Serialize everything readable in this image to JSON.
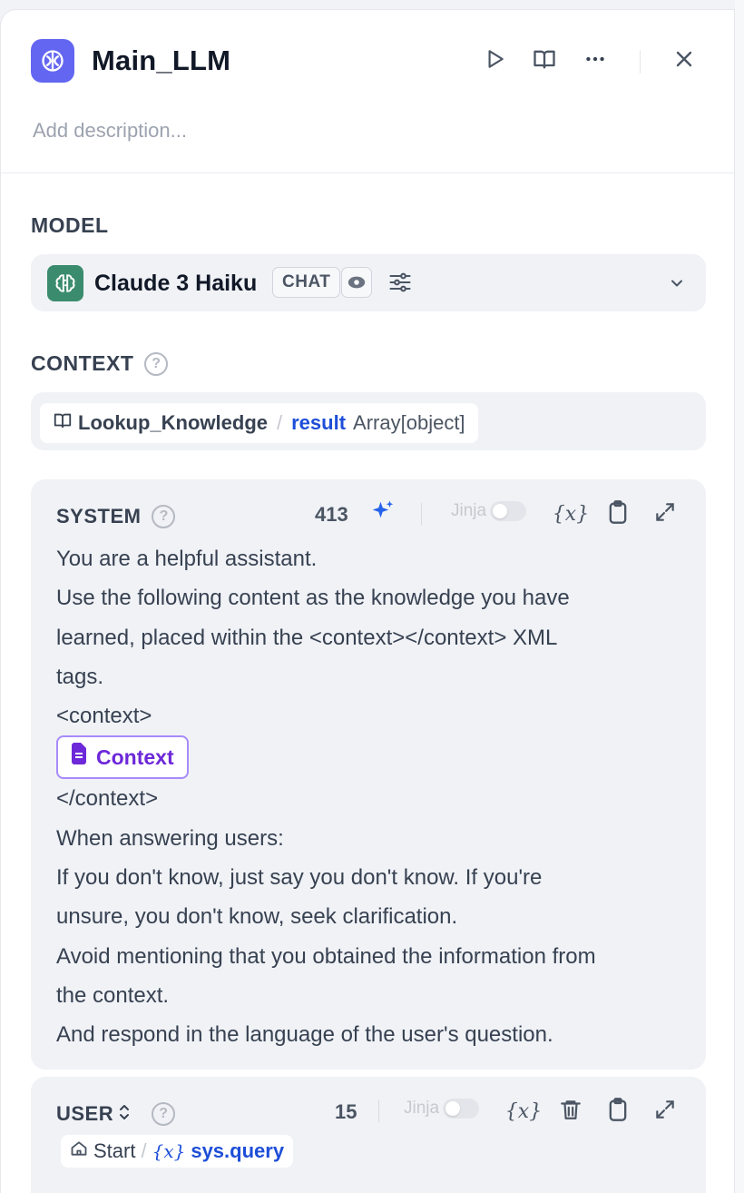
{
  "node": {
    "title": "Main_LLM",
    "description_placeholder": "Add description..."
  },
  "model": {
    "section_label": "MODEL",
    "name": "Claude 3 Haiku",
    "mode_badge": "CHAT"
  },
  "context": {
    "section_label": "CONTEXT",
    "help": "?",
    "node_name": "Lookup_Knowledge",
    "separator": "/",
    "variable": "result",
    "type": "Array[object]"
  },
  "system_prompt": {
    "role": "SYSTEM",
    "help": "?",
    "token_count": "413",
    "jinja_label": "Jinja",
    "lines": [
      "You are a helpful assistant.",
      "Use the following content as the knowledge you have",
      "learned, placed within the <context></context> XML",
      "tags.",
      "<context>",
      "</context>",
      "When answering users:",
      "If you don't know, just say you don't know. If you're",
      "unsure, you don't know, seek clarification.",
      "Avoid mentioning that you obtained the information from",
      "the context.",
      "And respond in the language of the user's question."
    ],
    "context_chip": "Context"
  },
  "user_prompt": {
    "role": "USER",
    "help": "?",
    "token_count": "15",
    "jinja_label": "Jinja",
    "var_node": "Start",
    "separator": "/",
    "var_name": "sys.query"
  },
  "colors": {
    "accent": "#6366f1",
    "model_icon": "#3b8c6e",
    "variable_blue": "#1d4ed8",
    "context_purple": "#6d28d9"
  },
  "icons": [
    "brain-icon",
    "play-icon",
    "book-icon",
    "more-icon",
    "close-icon",
    "sparkle-icon",
    "variable-icon",
    "clipboard-icon",
    "expand-icon",
    "trash-icon",
    "home-icon",
    "file-icon"
  ]
}
